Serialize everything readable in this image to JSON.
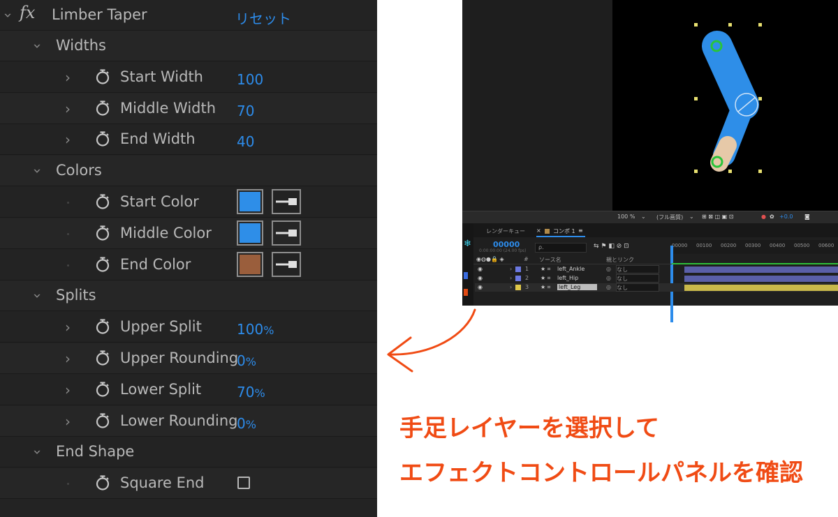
{
  "effect_panel": {
    "fx_glyph": "fx",
    "effect_name": "Limber Taper",
    "reset_label": "リセット",
    "rows": [
      {
        "kind": "group",
        "label": "Widths"
      },
      {
        "kind": "param",
        "label": "Start Width",
        "value": "100",
        "unit": ""
      },
      {
        "kind": "param",
        "label": "Middle Width",
        "value": "70",
        "unit": ""
      },
      {
        "kind": "param",
        "label": "End Width",
        "value": "40",
        "unit": ""
      },
      {
        "kind": "group",
        "label": "Colors"
      },
      {
        "kind": "color",
        "label": "Start Color",
        "color": "#2e8ee8"
      },
      {
        "kind": "color",
        "label": "Middle Color",
        "color": "#2e8ee8"
      },
      {
        "kind": "color",
        "label": "End Color",
        "color": "#9a5e3c"
      },
      {
        "kind": "group",
        "label": "Splits"
      },
      {
        "kind": "param",
        "label": "Upper Split",
        "value": "100",
        "unit": "%"
      },
      {
        "kind": "param",
        "label": "Upper Rounding",
        "value": "0",
        "unit": "%"
      },
      {
        "kind": "param",
        "label": "Lower Split",
        "value": "70",
        "unit": "%"
      },
      {
        "kind": "param",
        "label": "Lower Rounding",
        "value": "0",
        "unit": "%"
      },
      {
        "kind": "group",
        "label": "End Shape"
      },
      {
        "kind": "checkbox",
        "label": "Square End",
        "checked": false
      }
    ]
  },
  "viewer": {
    "zoom": "100 %",
    "resolution": "(フル画質)",
    "exposure": "+0.0",
    "limb_colors": {
      "primary": "#2e8ee8",
      "end": "#e6c9a8",
      "handle": "#29c43a",
      "bounds": "#e8e070"
    }
  },
  "timeline": {
    "tab_render_queue": "レンダーキュー",
    "tab_comp": "コンポ 1",
    "timecode": "00000",
    "timecode_sub": "0:00:00:00 (24.00 fps)",
    "search_placeholder": "ρ.",
    "col_source_name": "ソース名",
    "col_parent": "親とリンク",
    "col_number": "#",
    "ruler_ticks": [
      "00000",
      "00100",
      "00200",
      "00300",
      "00400",
      "00500",
      "00600"
    ],
    "layers": [
      {
        "num": "1",
        "name": "left_Ankle",
        "parent": "なし",
        "label_color": "#6b78e0"
      },
      {
        "num": "2",
        "name": "left_Hip",
        "parent": "なし",
        "label_color": "#6b78e0"
      },
      {
        "num": "3",
        "name": "left_Leg",
        "parent": "なし",
        "label_color": "#e0c84a"
      }
    ]
  },
  "annotation": {
    "line1": "手足レイヤーを選択して",
    "line2": "エフェクトコントロールパネルを確認",
    "accent_color": "#f04b14"
  }
}
